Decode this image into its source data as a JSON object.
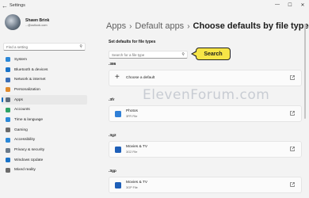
{
  "window": {
    "title": "Settings",
    "controls": {
      "minimize": "—",
      "maximize": "☐",
      "close": "✕"
    }
  },
  "profile": {
    "name": "Shawn Brink",
    "email": "...@outlook.com"
  },
  "sidebar_search": {
    "placeholder": "Find a setting"
  },
  "nav": [
    {
      "label": "System",
      "icon": "system-icon",
      "color": "#2b88d8"
    },
    {
      "label": "Bluetooth & devices",
      "icon": "bluetooth-icon",
      "color": "#1a73c8"
    },
    {
      "label": "Network & internet",
      "icon": "network-icon",
      "color": "#3a6fb8"
    },
    {
      "label": "Personalization",
      "icon": "personalization-icon",
      "color": "#e08a2c"
    },
    {
      "label": "Apps",
      "icon": "apps-icon",
      "color": "#5b6b7c",
      "active": true
    },
    {
      "label": "Accounts",
      "icon": "accounts-icon",
      "color": "#2fa366"
    },
    {
      "label": "Time & language",
      "icon": "time-language-icon",
      "color": "#2b88d8"
    },
    {
      "label": "Gaming",
      "icon": "gaming-icon",
      "color": "#6b6b6b"
    },
    {
      "label": "Accessibility",
      "icon": "accessibility-icon",
      "color": "#2b88d8"
    },
    {
      "label": "Privacy & security",
      "icon": "privacy-icon",
      "color": "#6b7a8a"
    },
    {
      "label": "Windows Update",
      "icon": "windows-update-icon",
      "color": "#1a73c8"
    },
    {
      "label": "Mixed reality",
      "icon": "mixed-reality-icon",
      "color": "#6b6b6b"
    }
  ],
  "breadcrumb": {
    "items": [
      "Apps",
      "Default apps"
    ],
    "current": "Choose defaults by file type",
    "separator": "›"
  },
  "main": {
    "subtitle": "Set defaults for file types",
    "search_placeholder": "Search for a file type",
    "callout_label": "Search",
    "callout_color": "#f7e547"
  },
  "file_types": [
    {
      "ext": ".386",
      "kind": "choose",
      "label": "Choose a default"
    },
    {
      "ext": ".3fr",
      "kind": "app",
      "app": "Photos",
      "type": "3FR File",
      "icon": "photos-icon",
      "color": "#2f7fd6"
    },
    {
      "ext": ".3g2",
      "kind": "app",
      "app": "Movies & TV",
      "type": "3G2 File",
      "icon": "movies-tv-icon",
      "color": "#1e5fb8"
    },
    {
      "ext": ".3gp",
      "kind": "app",
      "app": "Movies & TV",
      "type": "3GP File",
      "icon": "movies-tv-icon",
      "color": "#1e5fb8"
    }
  ],
  "watermark": "ElevenForum.com"
}
